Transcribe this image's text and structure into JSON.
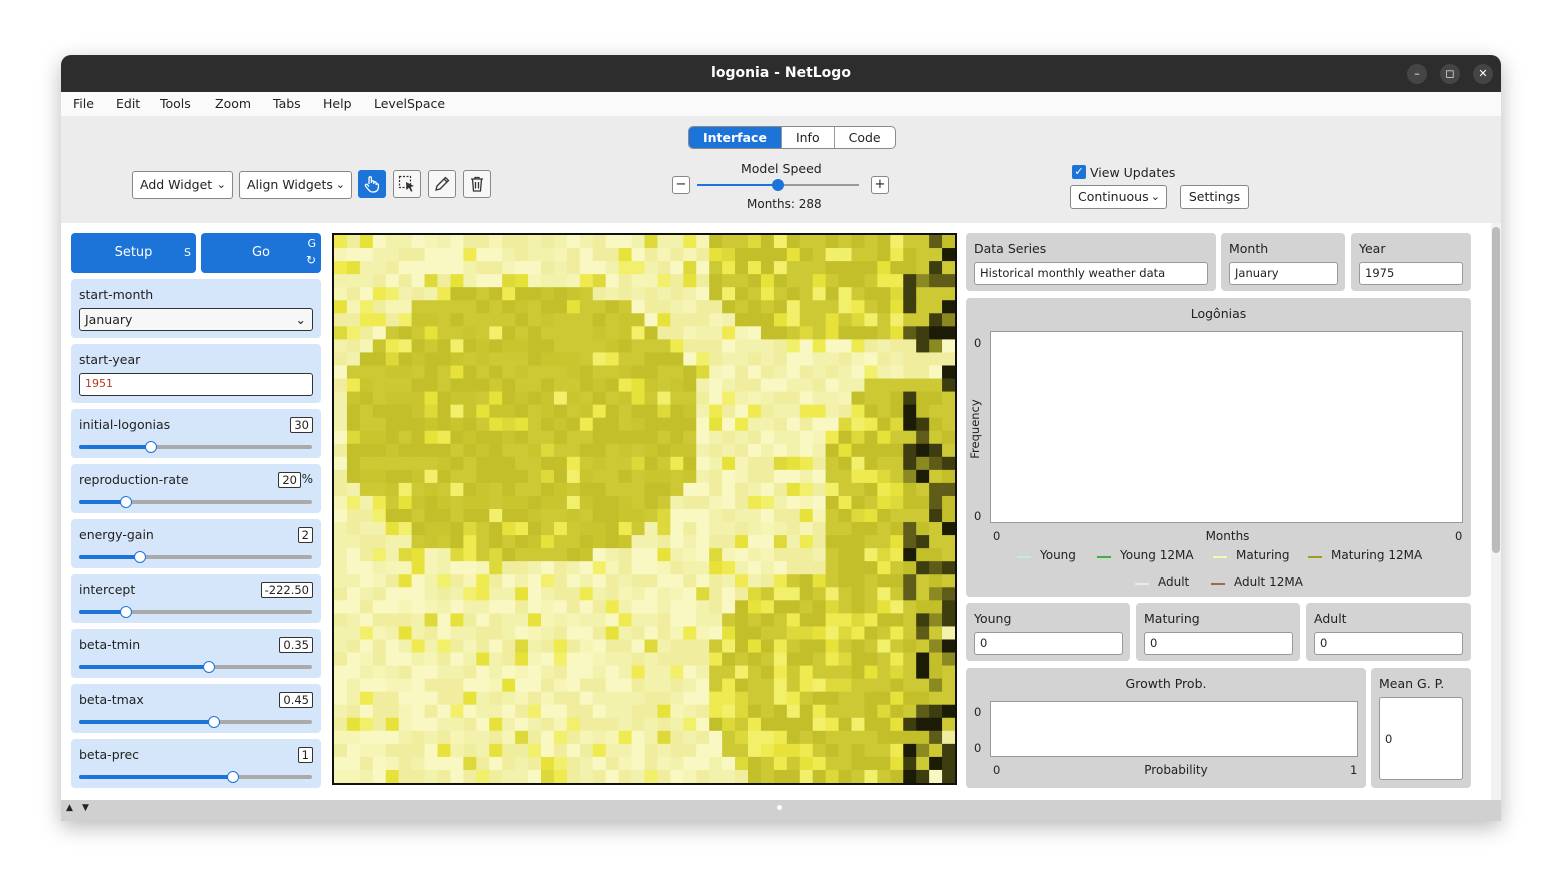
{
  "window": {
    "title": "logonia - NetLogo"
  },
  "menu": [
    "File",
    "Edit",
    "Tools",
    "Zoom",
    "Tabs",
    "Help",
    "LevelSpace"
  ],
  "tabs": [
    "Interface",
    "Info",
    "Code"
  ],
  "toolbar": {
    "add_widget": "Add Widget",
    "align_widgets": "Align Widgets",
    "model_speed_label": "Model Speed",
    "speed_minus": "−",
    "speed_plus": "+",
    "speed_level": 0.5,
    "ticks_label": "Months: 288",
    "view_updates_label": "View Updates",
    "update_mode": "Continuous",
    "settings": "Settings"
  },
  "buttons": {
    "setup": {
      "label": "Setup",
      "key": "S"
    },
    "go": {
      "label": "Go",
      "key": "G",
      "forever_icon": "↻"
    }
  },
  "chooser": {
    "label": "start-month",
    "value": "January"
  },
  "input_start_year": {
    "label": "start-year",
    "value": "1951"
  },
  "sliders": [
    {
      "label": "initial-logonias",
      "value": "30",
      "unit": "",
      "fraction": 0.31
    },
    {
      "label": "reproduction-rate",
      "value": "20",
      "unit": "%",
      "fraction": 0.2
    },
    {
      "label": "energy-gain",
      "value": "2",
      "unit": "",
      "fraction": 0.26
    },
    {
      "label": "intercept",
      "value": "-222.50",
      "unit": "",
      "fraction": 0.2
    },
    {
      "label": "beta-tmin",
      "value": "0.35",
      "unit": "",
      "fraction": 0.56
    },
    {
      "label": "beta-tmax",
      "value": "0.45",
      "unit": "",
      "fraction": 0.58
    },
    {
      "label": "beta-prec",
      "value": "1",
      "unit": "",
      "fraction": 0.66
    }
  ],
  "monitors_top": [
    {
      "label": "Data Series",
      "value": "Historical monthly weather data"
    },
    {
      "label": "Month",
      "value": "January"
    },
    {
      "label": "Year",
      "value": "1975"
    }
  ],
  "plot_logonias": {
    "title": "Logônias",
    "ylabel": "Frequency",
    "xlabel": "Months",
    "y_max": "0",
    "y_min": "0",
    "x_min": "0",
    "x_max": "0",
    "legend": [
      {
        "name": "Young",
        "color": "#c9e9df"
      },
      {
        "name": "Young 12MA",
        "color": "#3cb043"
      },
      {
        "name": "Maturing",
        "color": "#f7f7b4"
      },
      {
        "name": "Maturing 12MA",
        "color": "#a19b1f"
      },
      {
        "name": "Adult",
        "color": "#ecebe2"
      },
      {
        "name": "Adult 12MA",
        "color": "#9c6b47"
      }
    ]
  },
  "monitors_counts": [
    {
      "label": "Young",
      "value": "0"
    },
    {
      "label": "Maturing",
      "value": "0"
    },
    {
      "label": "Adult",
      "value": "0"
    }
  ],
  "plot_growth": {
    "title": "Growth Prob.",
    "xlabel": "Probability",
    "y_max": "0",
    "y_min": "0",
    "x_min": "0",
    "x_max": "1"
  },
  "monitor_mean": {
    "label": "Mean G. P.",
    "value": "0"
  },
  "colors": {
    "accent": "#1c73d8",
    "widget_blue": "#d5e6fb",
    "widget_gray": "#d3d3d3"
  }
}
